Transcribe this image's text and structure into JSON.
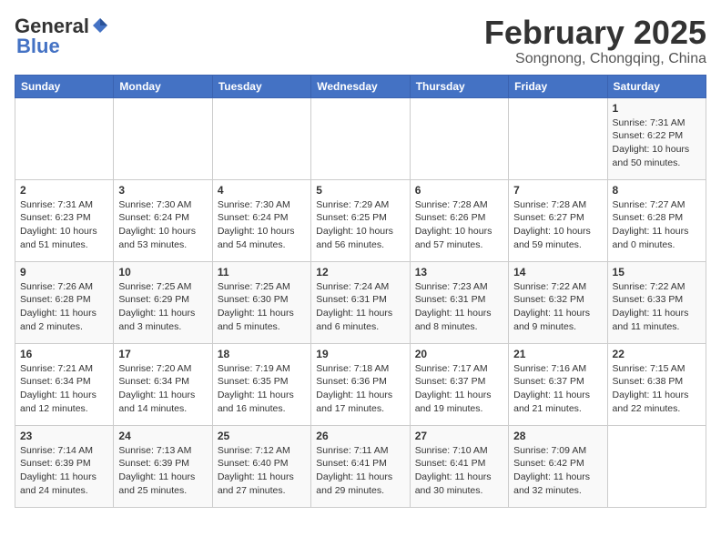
{
  "logo": {
    "general": "General",
    "blue": "Blue"
  },
  "header": {
    "month_title": "February 2025",
    "location": "Songnong, Chongqing, China"
  },
  "days_of_week": [
    "Sunday",
    "Monday",
    "Tuesday",
    "Wednesday",
    "Thursday",
    "Friday",
    "Saturday"
  ],
  "weeks": [
    [
      {
        "day": "",
        "info": ""
      },
      {
        "day": "",
        "info": ""
      },
      {
        "day": "",
        "info": ""
      },
      {
        "day": "",
        "info": ""
      },
      {
        "day": "",
        "info": ""
      },
      {
        "day": "",
        "info": ""
      },
      {
        "day": "1",
        "info": "Sunrise: 7:31 AM\nSunset: 6:22 PM\nDaylight: 10 hours and 50 minutes."
      }
    ],
    [
      {
        "day": "2",
        "info": "Sunrise: 7:31 AM\nSunset: 6:23 PM\nDaylight: 10 hours and 51 minutes."
      },
      {
        "day": "3",
        "info": "Sunrise: 7:30 AM\nSunset: 6:24 PM\nDaylight: 10 hours and 53 minutes."
      },
      {
        "day": "4",
        "info": "Sunrise: 7:30 AM\nSunset: 6:24 PM\nDaylight: 10 hours and 54 minutes."
      },
      {
        "day": "5",
        "info": "Sunrise: 7:29 AM\nSunset: 6:25 PM\nDaylight: 10 hours and 56 minutes."
      },
      {
        "day": "6",
        "info": "Sunrise: 7:28 AM\nSunset: 6:26 PM\nDaylight: 10 hours and 57 minutes."
      },
      {
        "day": "7",
        "info": "Sunrise: 7:28 AM\nSunset: 6:27 PM\nDaylight: 10 hours and 59 minutes."
      },
      {
        "day": "8",
        "info": "Sunrise: 7:27 AM\nSunset: 6:28 PM\nDaylight: 11 hours and 0 minutes."
      }
    ],
    [
      {
        "day": "9",
        "info": "Sunrise: 7:26 AM\nSunset: 6:28 PM\nDaylight: 11 hours and 2 minutes."
      },
      {
        "day": "10",
        "info": "Sunrise: 7:25 AM\nSunset: 6:29 PM\nDaylight: 11 hours and 3 minutes."
      },
      {
        "day": "11",
        "info": "Sunrise: 7:25 AM\nSunset: 6:30 PM\nDaylight: 11 hours and 5 minutes."
      },
      {
        "day": "12",
        "info": "Sunrise: 7:24 AM\nSunset: 6:31 PM\nDaylight: 11 hours and 6 minutes."
      },
      {
        "day": "13",
        "info": "Sunrise: 7:23 AM\nSunset: 6:31 PM\nDaylight: 11 hours and 8 minutes."
      },
      {
        "day": "14",
        "info": "Sunrise: 7:22 AM\nSunset: 6:32 PM\nDaylight: 11 hours and 9 minutes."
      },
      {
        "day": "15",
        "info": "Sunrise: 7:22 AM\nSunset: 6:33 PM\nDaylight: 11 hours and 11 minutes."
      }
    ],
    [
      {
        "day": "16",
        "info": "Sunrise: 7:21 AM\nSunset: 6:34 PM\nDaylight: 11 hours and 12 minutes."
      },
      {
        "day": "17",
        "info": "Sunrise: 7:20 AM\nSunset: 6:34 PM\nDaylight: 11 hours and 14 minutes."
      },
      {
        "day": "18",
        "info": "Sunrise: 7:19 AM\nSunset: 6:35 PM\nDaylight: 11 hours and 16 minutes."
      },
      {
        "day": "19",
        "info": "Sunrise: 7:18 AM\nSunset: 6:36 PM\nDaylight: 11 hours and 17 minutes."
      },
      {
        "day": "20",
        "info": "Sunrise: 7:17 AM\nSunset: 6:37 PM\nDaylight: 11 hours and 19 minutes."
      },
      {
        "day": "21",
        "info": "Sunrise: 7:16 AM\nSunset: 6:37 PM\nDaylight: 11 hours and 21 minutes."
      },
      {
        "day": "22",
        "info": "Sunrise: 7:15 AM\nSunset: 6:38 PM\nDaylight: 11 hours and 22 minutes."
      }
    ],
    [
      {
        "day": "23",
        "info": "Sunrise: 7:14 AM\nSunset: 6:39 PM\nDaylight: 11 hours and 24 minutes."
      },
      {
        "day": "24",
        "info": "Sunrise: 7:13 AM\nSunset: 6:39 PM\nDaylight: 11 hours and 25 minutes."
      },
      {
        "day": "25",
        "info": "Sunrise: 7:12 AM\nSunset: 6:40 PM\nDaylight: 11 hours and 27 minutes."
      },
      {
        "day": "26",
        "info": "Sunrise: 7:11 AM\nSunset: 6:41 PM\nDaylight: 11 hours and 29 minutes."
      },
      {
        "day": "27",
        "info": "Sunrise: 7:10 AM\nSunset: 6:41 PM\nDaylight: 11 hours and 30 minutes."
      },
      {
        "day": "28",
        "info": "Sunrise: 7:09 AM\nSunset: 6:42 PM\nDaylight: 11 hours and 32 minutes."
      },
      {
        "day": "",
        "info": ""
      }
    ]
  ]
}
